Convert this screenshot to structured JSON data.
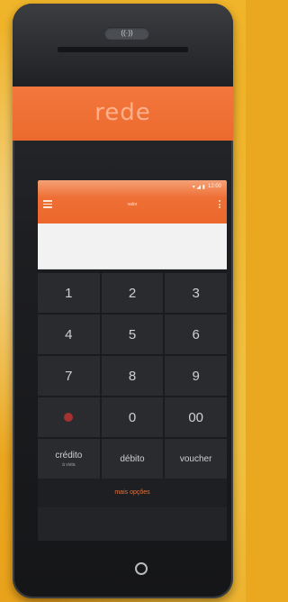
{
  "device": {
    "nfc_label": "((·))",
    "brand": "rede"
  },
  "screen": {
    "status": {
      "icons": "▾ ◢ ▮",
      "time": "12:00"
    },
    "app_title": "valor",
    "amount_value": "",
    "keypad": [
      {
        "label": "1"
      },
      {
        "label": "2"
      },
      {
        "label": "3"
      },
      {
        "label": "4"
      },
      {
        "label": "5"
      },
      {
        "label": "6"
      },
      {
        "label": "7"
      },
      {
        "label": "8"
      },
      {
        "label": "9"
      },
      {
        "label": ""
      },
      {
        "label": "0"
      },
      {
        "label": "00"
      }
    ],
    "payment_buttons": [
      {
        "label": "crédito",
        "sub": "à vista"
      },
      {
        "label": "débito",
        "sub": ""
      },
      {
        "label": "voucher",
        "sub": ""
      }
    ],
    "more_options": "mais opções"
  },
  "colors": {
    "brand_orange": "#ec6a2d",
    "background_yellow": "#e9a820",
    "cancel_red": "#a4322f"
  }
}
